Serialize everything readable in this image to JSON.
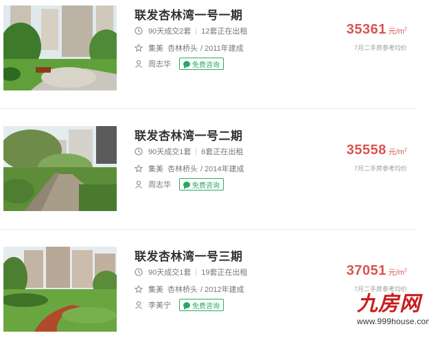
{
  "listings": [
    {
      "title": "联发杏林湾一号一期",
      "deals": "90天成交2套",
      "renting": "12套正在出租",
      "district": "集美",
      "area": "杏林桥头",
      "built": "/ 2011年建成",
      "agent": "周志华",
      "consult": "免费咨询",
      "price": "35361",
      "unit": "元/m",
      "unit_sup": "2",
      "avg_note": "7月二手房参考均价"
    },
    {
      "title": "联发杏林湾一号二期",
      "deals": "90天成交1套",
      "renting": "6套正在出租",
      "district": "集美",
      "area": "杏林桥头",
      "built": "/ 2014年建成",
      "agent": "周志华",
      "consult": "免费咨询",
      "price": "35558",
      "unit": "元/m",
      "unit_sup": "2",
      "avg_note": "7月二手房参考均价"
    },
    {
      "title": "联发杏林湾一号三期",
      "deals": "90天成交1套",
      "renting": "19套正在出租",
      "district": "集美",
      "area": "杏林桥头",
      "built": "/ 2012年建成",
      "agent": "李美宁",
      "consult": "免费咨询",
      "price": "37051",
      "unit": "元/m",
      "unit_sup": "2",
      "avg_note": "7月二手房参考均价"
    }
  ],
  "watermark": {
    "logo": "九房网",
    "url": "www.999house.com"
  },
  "colors": {
    "price": "#d9534f",
    "consult": "#2aa861",
    "brand": "#c81e1e"
  },
  "icons": [
    "clock-icon",
    "star-icon",
    "user-icon",
    "chat-bubble-icon"
  ]
}
